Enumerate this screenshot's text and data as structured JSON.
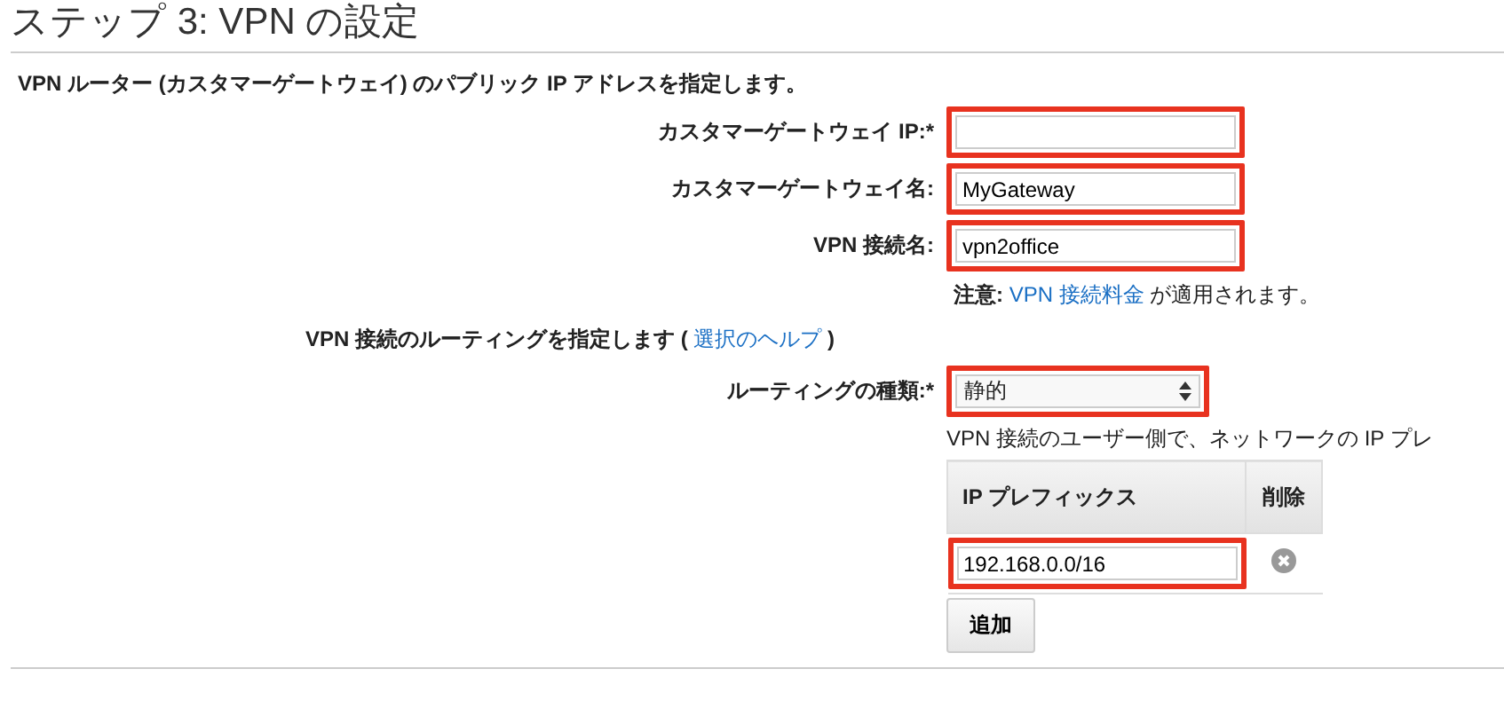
{
  "title": "ステップ 3: VPN の設定",
  "intro": "VPN ルーター (カスタマーゲートウェイ) のパブリック IP アドレスを指定します。",
  "fields": [
    {
      "label": "カスタマーゲートウェイ IP:*",
      "highlighted": true
    },
    {
      "label": "カスタマーゲートウェイ名:",
      "value": "MyGateway",
      "highlighted": true
    },
    {
      "label": "VPN 接続名:",
      "value": "vpn2office",
      "highlighted": true
    }
  ],
  "note": {
    "label": "注意:",
    "link": "VPN 接続料金",
    "text": "が適用されます。"
  },
  "routing_heading": {
    "text": "VPN 接続のルーティングを指定します (",
    "link": "選択のヘルプ",
    "close": ")"
  },
  "routing_type": {
    "label": "ルーティングの種類:*",
    "value": "静的",
    "highlighted": true
  },
  "routing_description": "VPN 接続のユーザー側で、ネットワークの IP プレ",
  "prefix_table": {
    "columns": [
      "IP プレフィックス",
      "削除"
    ],
    "rows": [
      {
        "prefix": "192.168.0.0/16",
        "highlighted": true
      }
    ]
  },
  "add_button": "追加"
}
